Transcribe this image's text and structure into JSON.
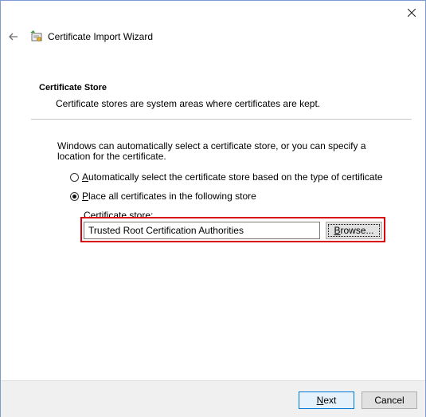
{
  "window": {
    "title": "Certificate Import Wizard",
    "close_icon": "close-icon",
    "back_icon": "back-arrow-icon",
    "app_icon": "certificate-icon"
  },
  "section": {
    "title": "Certificate Store",
    "description": "Certificate stores are system areas where certificates are kept."
  },
  "intro": "Windows can automatically select a certificate store, or you can specify a location for the certificate.",
  "options": [
    {
      "mnemonic": "A",
      "rest": "utomatically select the certificate store based on the type of certificate",
      "checked": false
    },
    {
      "mnemonic": "P",
      "rest": "lace all certificates in the following store",
      "checked": true
    }
  ],
  "store": {
    "label": "Certificate store:",
    "value": "Trusted Root Certification Authorities",
    "browse_mnemonic": "B",
    "browse_rest": "rowse..."
  },
  "buttons": {
    "next_mnemonic": "N",
    "next_rest": "ext",
    "cancel": "Cancel"
  },
  "colors": {
    "highlight_border": "#d9000e",
    "default_button_border": "#0078d7"
  }
}
